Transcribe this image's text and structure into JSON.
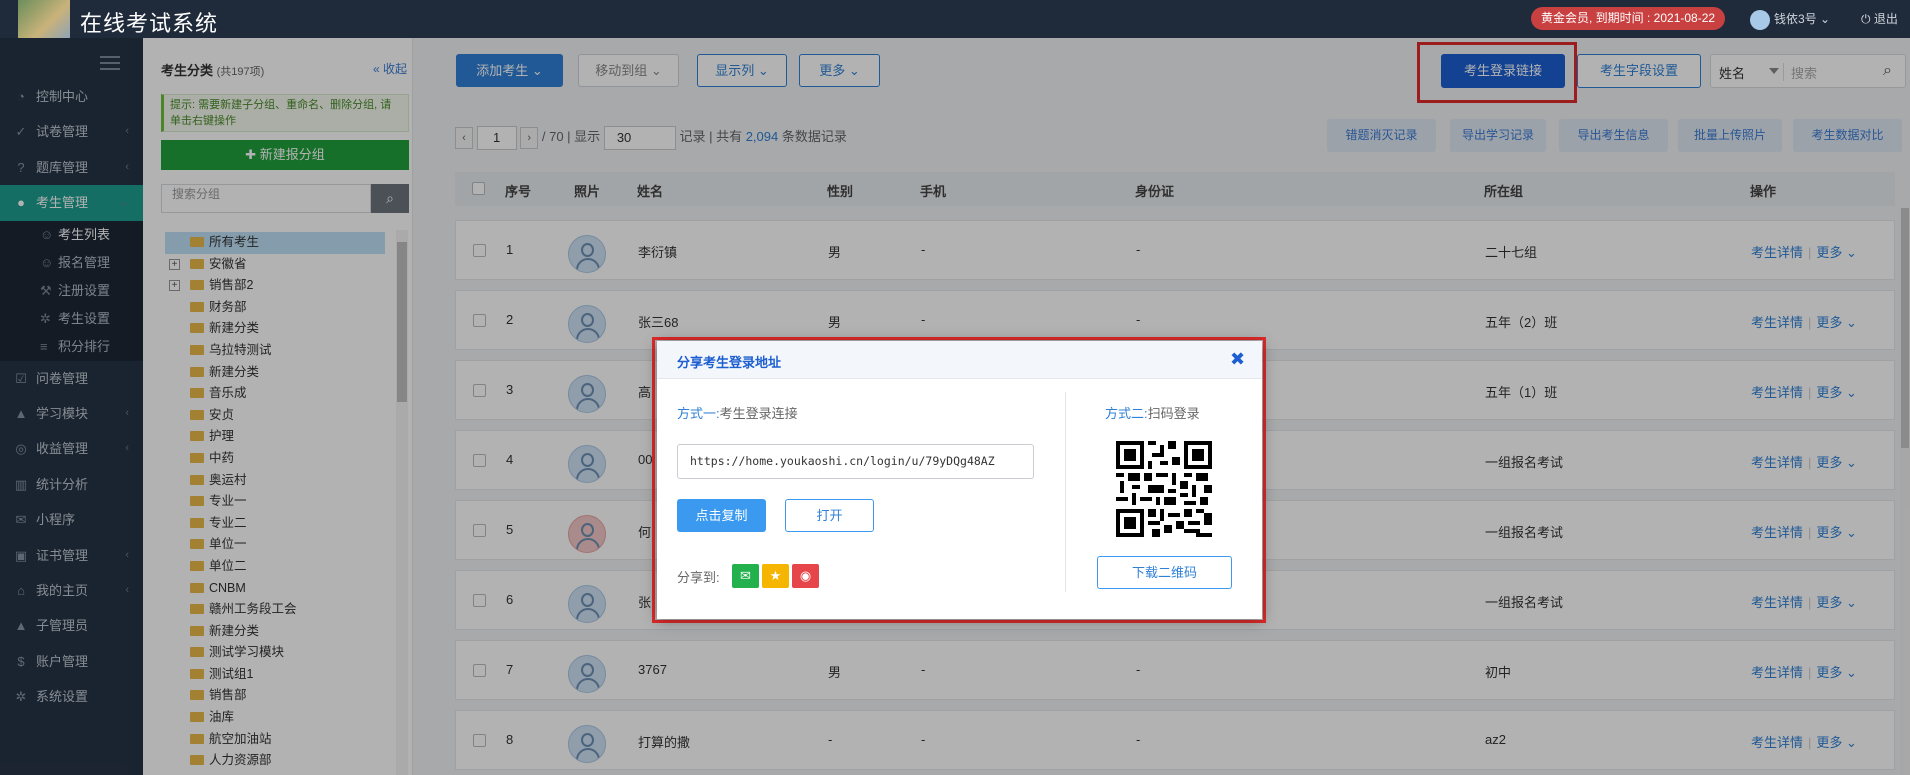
{
  "header": {
    "app_title": "在线考试系统",
    "vip_badge": "黄金会员, 到期时间 : 2021-08-22",
    "username": "钱依3号",
    "logout": "退出"
  },
  "sidebar": {
    "items": [
      {
        "label": "控制中心",
        "icon": "dashboard-icon",
        "arrow": ""
      },
      {
        "label": "试卷管理",
        "icon": "check-circle-icon",
        "arrow": "‹"
      },
      {
        "label": "题库管理",
        "icon": "question-icon",
        "arrow": "‹"
      },
      {
        "label": "考生管理",
        "icon": "user-icon",
        "arrow": "⌄",
        "active": true
      },
      {
        "label": "问卷管理",
        "icon": "checkbox-icon",
        "arrow": ""
      },
      {
        "label": "学习模块",
        "icon": "graduation-icon",
        "arrow": "‹"
      },
      {
        "label": "收益管理",
        "icon": "coin-icon",
        "arrow": "‹"
      },
      {
        "label": "统计分析",
        "icon": "bar-chart-icon",
        "arrow": ""
      },
      {
        "label": "小程序",
        "icon": "wechat-icon",
        "arrow": ""
      },
      {
        "label": "证书管理",
        "icon": "certificate-icon",
        "arrow": "‹"
      },
      {
        "label": "我的主页",
        "icon": "home-icon",
        "arrow": "‹"
      },
      {
        "label": "子管理员",
        "icon": "lock-icon",
        "arrow": ""
      },
      {
        "label": "账户管理",
        "icon": "dollar-icon",
        "arrow": ""
      },
      {
        "label": "系统设置",
        "icon": "gear-icon",
        "arrow": ""
      }
    ],
    "sub_items": [
      {
        "label": "考生列表",
        "icon": "users-icon",
        "current": true
      },
      {
        "label": "报名管理",
        "icon": "user-plus-icon"
      },
      {
        "label": "注册设置",
        "icon": "wrench-icon"
      },
      {
        "label": "考生设置",
        "icon": "gear-icon"
      },
      {
        "label": "积分排行",
        "icon": "list-icon"
      }
    ]
  },
  "category": {
    "title": "考生分类",
    "count": "(共197项)",
    "collapse": "收起",
    "tip": "提示: 需要新建子分组、重命名、删除分组, 请单击右键操作",
    "new_group": "新建报分组",
    "search_placeholder": "搜索分组",
    "tree": [
      {
        "label": "所有考生",
        "selected": true
      },
      {
        "label": "安徽省",
        "expandable": true
      },
      {
        "label": "销售部2",
        "expandable": true
      },
      {
        "label": "财务部"
      },
      {
        "label": "新建分类"
      },
      {
        "label": "乌拉特测试"
      },
      {
        "label": "新建分类"
      },
      {
        "label": "音乐成"
      },
      {
        "label": "安贞"
      },
      {
        "label": "护理"
      },
      {
        "label": "中药"
      },
      {
        "label": "奥运村"
      },
      {
        "label": "专业一"
      },
      {
        "label": "专业二"
      },
      {
        "label": "单位一"
      },
      {
        "label": "单位二"
      },
      {
        "label": "CNBM"
      },
      {
        "label": "赣州工务段工会"
      },
      {
        "label": "新建分类"
      },
      {
        "label": "测试学习模块"
      },
      {
        "label": "测试组1"
      },
      {
        "label": "销售部"
      },
      {
        "label": "油库"
      },
      {
        "label": "航空加油站"
      },
      {
        "label": "人力资源部"
      }
    ]
  },
  "toolbar": {
    "add_student": "添加考生 ⌄",
    "move_group": "移动到组 ⌄",
    "show_cols": "显示列 ⌄",
    "more": "更多 ⌄",
    "login_link": "考生登录链接",
    "field_settings": "考生字段设置",
    "search_field": "姓名",
    "search_placeholder": "搜索"
  },
  "pager": {
    "page": "1",
    "total_pages": "/ 70",
    "show_label": "显示",
    "page_size": "30",
    "records_label": "记录",
    "total_prefix": "共有",
    "total_count": "2,094",
    "total_suffix": "条数据记录"
  },
  "actions": [
    {
      "label": "错题消灭记录"
    },
    {
      "label": "导出学习记录"
    },
    {
      "label": "导出考生信息"
    },
    {
      "label": "批量上传照片"
    },
    {
      "label": "考生数据对比"
    }
  ],
  "table": {
    "headers": {
      "no": "序号",
      "photo": "照片",
      "name": "姓名",
      "gender": "性别",
      "phone": "手机",
      "id": "身份证",
      "group": "所在组",
      "ops": "操作"
    },
    "detail_label": "考生详情",
    "more_label": "更多 ⌄",
    "rows": [
      {
        "no": "1",
        "name": "李衍镇",
        "gender": "男",
        "phone": "-",
        "id": "-",
        "group": "二十七组"
      },
      {
        "no": "2",
        "name": "张三68",
        "gender": "男",
        "phone": "-",
        "id": "-",
        "group": "五年（2）班"
      },
      {
        "no": "3",
        "name": "高",
        "gender": "",
        "phone": "",
        "id": "",
        "group": "五年（1）班"
      },
      {
        "no": "4",
        "name": "00",
        "gender": "",
        "phone": "",
        "id": "",
        "group": "一组报名考试"
      },
      {
        "no": "5",
        "name": "何",
        "gender": "",
        "phone": "",
        "id": "",
        "group": "一组报名考试",
        "pink": true
      },
      {
        "no": "6",
        "name": "张",
        "gender": "",
        "phone": "",
        "id": "",
        "group": "一组报名考试"
      },
      {
        "no": "7",
        "name": "3767",
        "gender": "男",
        "phone": "-",
        "id": "-",
        "group": "初中"
      },
      {
        "no": "8",
        "name": "打算的撒",
        "gender": "-",
        "phone": "-",
        "id": "-",
        "group": "az2"
      }
    ]
  },
  "modal": {
    "title": "分享考生登录地址",
    "close": "✖",
    "method1_key": "方式一:",
    "method1_val": "考生登录连接",
    "url": "https://home.youkaoshi.cn/login/u/79yDQg48AZ",
    "copy": "点击复制",
    "open": "打开",
    "share_to": "分享到:",
    "method2_key": "方式二:",
    "method2_val": "扫码登录",
    "download_qr": "下载二维码"
  },
  "colors": {
    "accent": "#2f80d6",
    "active_nav": "#1e9e8e",
    "highlight": "#e02a2a",
    "wechat": "#22b14c",
    "qzone": "#f5b500",
    "weibo": "#e6454a"
  }
}
